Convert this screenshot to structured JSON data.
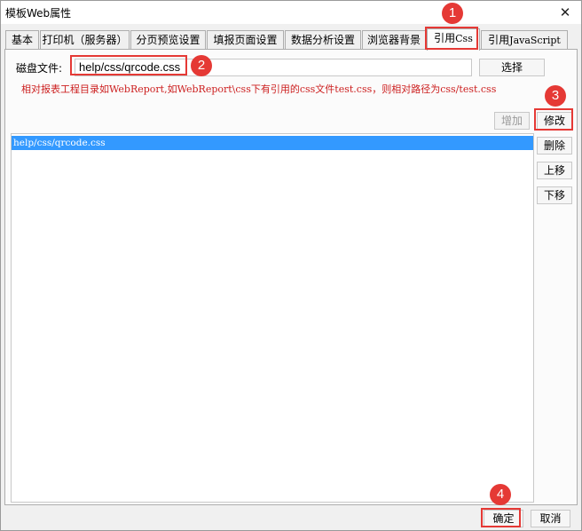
{
  "window": {
    "title": "模板Web属性",
    "close_glyph": "✕"
  },
  "tabs": [
    {
      "label": "基本"
    },
    {
      "label": "打印机（服务器）"
    },
    {
      "label": "分页预览设置"
    },
    {
      "label": "填报页面设置"
    },
    {
      "label": "数据分析设置"
    },
    {
      "label": "浏览器背景"
    },
    {
      "label_prefix": "引用",
      "label_suffix": "Css"
    },
    {
      "label_prefix": "引用",
      "label_suffix": "JavaScript"
    }
  ],
  "css_panel": {
    "file_label": "磁盘文件:",
    "file_value": "help/css/qrcode.css",
    "select_label": "选择",
    "hint": "相对报表工程目录如WebReport,如WebReport\\css下有引用的css文件test.css，则相对路径为css/test.css",
    "add_label": "增加",
    "edit_label": "修改",
    "delete_label": "删除",
    "move_up_label": "上移",
    "move_down_label": "下移",
    "list_items": [
      "help/css/qrcode.css"
    ]
  },
  "footer": {
    "ok_label": "确定",
    "cancel_label": "取消"
  },
  "markers": [
    "1",
    "2",
    "3",
    "4"
  ],
  "colors": {
    "accent_red": "#e53935",
    "selection_blue": "#3399ff",
    "hint_red": "#cc1f1f"
  }
}
